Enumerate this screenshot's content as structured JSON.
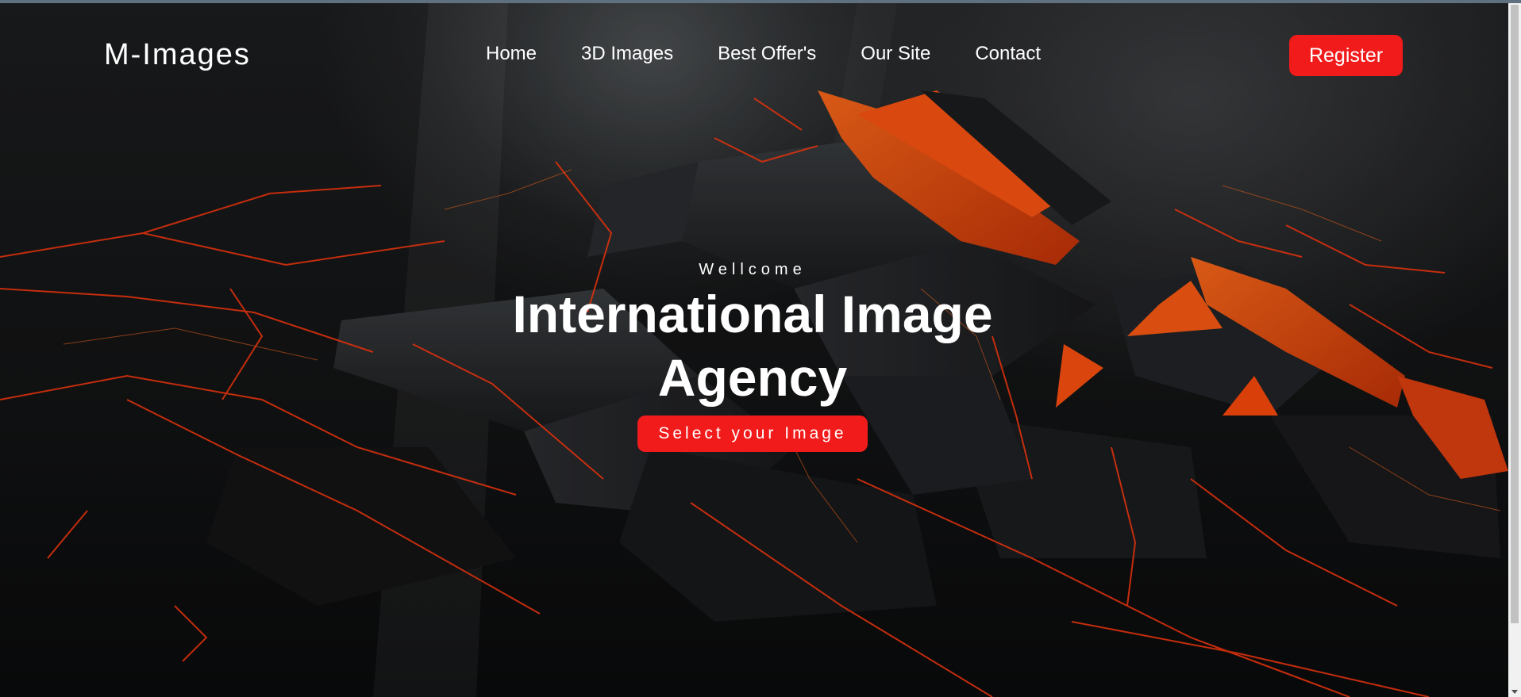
{
  "header": {
    "logo": "M-Images",
    "nav": [
      "Home",
      "3D Images",
      "Best Offer's",
      "Our Site",
      "Contact"
    ],
    "register_label": "Register"
  },
  "hero": {
    "welcome": "Wellcome",
    "headline_line1": "International Image",
    "headline_line2": "Agency",
    "cta_label": "Select your Image"
  },
  "colors": {
    "accent": "#f21b1b",
    "glow": "#ff4a0a",
    "background": "#111213"
  }
}
